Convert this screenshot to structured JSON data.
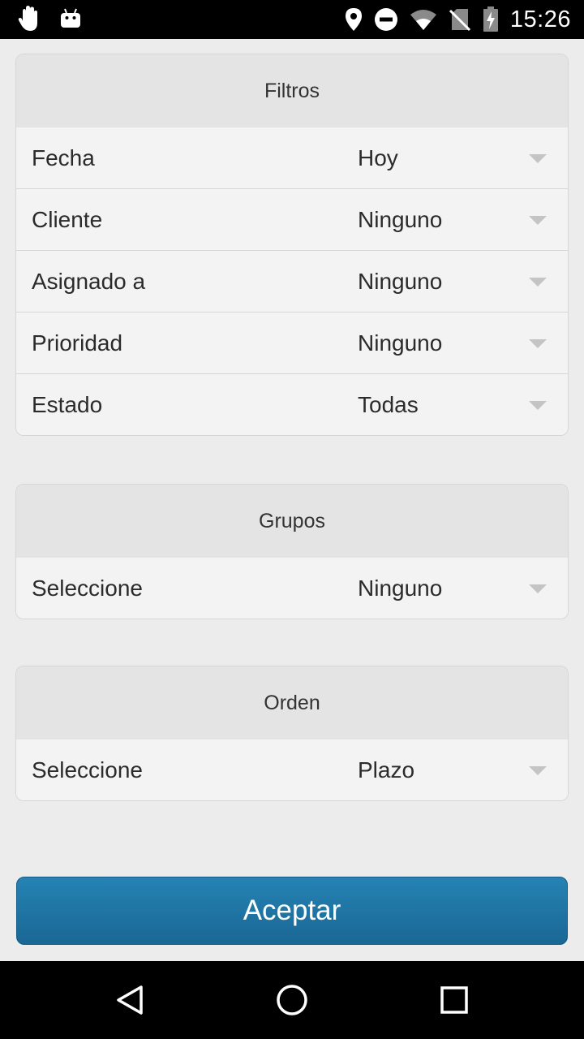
{
  "status_bar": {
    "time": "15:26",
    "left_icons": [
      "hand-icon",
      "android-icon"
    ],
    "right_icons": [
      "location-icon",
      "do-not-disturb-icon",
      "wifi-icon",
      "no-sim-icon",
      "battery-charging-icon"
    ]
  },
  "filters": {
    "title": "Filtros",
    "rows": [
      {
        "label": "Fecha",
        "value": "Hoy"
      },
      {
        "label": "Cliente",
        "value": "Ninguno"
      },
      {
        "label": "Asignado a",
        "value": "Ninguno"
      },
      {
        "label": "Prioridad",
        "value": "Ninguno"
      },
      {
        "label": "Estado",
        "value": "Todas"
      }
    ]
  },
  "groups": {
    "title": "Grupos",
    "rows": [
      {
        "label": "Seleccione",
        "value": "Ninguno"
      }
    ]
  },
  "order": {
    "title": "Orden",
    "rows": [
      {
        "label": "Seleccione",
        "value": "Plazo"
      }
    ]
  },
  "accept_label": "Aceptar",
  "nav_bar": {
    "icons": [
      "back-icon",
      "home-icon",
      "recents-icon"
    ]
  },
  "colors": {
    "accent": "#1f77a8",
    "panel_header": "#e4e4e4",
    "background": "#ececec"
  }
}
